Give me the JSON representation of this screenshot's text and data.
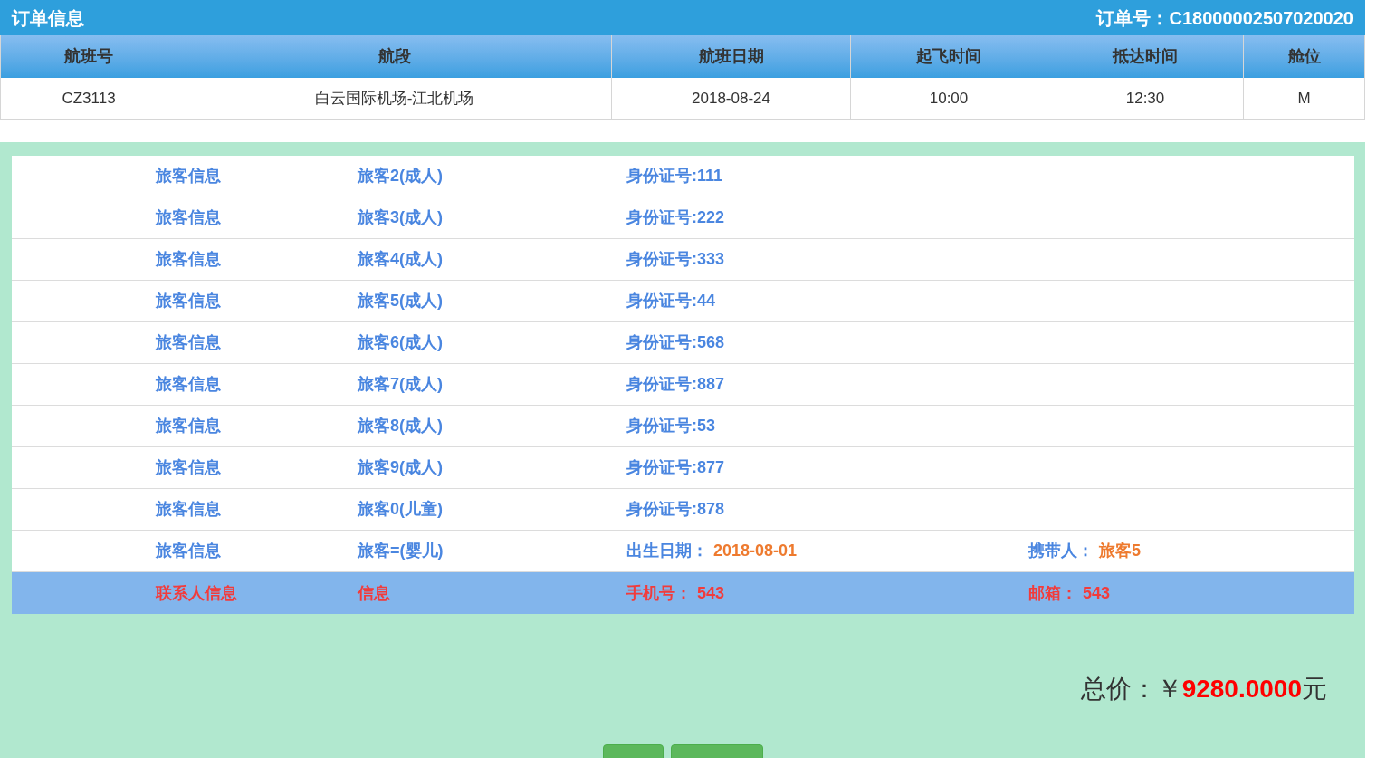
{
  "header": {
    "title": "订单信息",
    "order_number": "订单号：C18000002507020020"
  },
  "flight_table": {
    "columns": [
      "航班号",
      "航段",
      "航班日期",
      "起飞时间",
      "抵达时间",
      "舱位"
    ],
    "rows": [
      [
        "CZ3113",
        "白云国际机场-江北机场",
        "2018-08-24",
        "10:00",
        "12:30",
        "M"
      ]
    ]
  },
  "passenger_rows": [
    {
      "kind": "passenger",
      "cells": [
        {
          "text": "旅客信息"
        },
        {
          "text": "旅客2(成人)"
        },
        {
          "text": "身份证号:111"
        }
      ]
    },
    {
      "kind": "passenger",
      "cells": [
        {
          "text": "旅客信息"
        },
        {
          "text": "旅客3(成人)"
        },
        {
          "text": "身份证号:222"
        }
      ]
    },
    {
      "kind": "passenger",
      "cells": [
        {
          "text": "旅客信息"
        },
        {
          "text": "旅客4(成人)"
        },
        {
          "text": "身份证号:333"
        }
      ]
    },
    {
      "kind": "passenger",
      "cells": [
        {
          "text": "旅客信息"
        },
        {
          "text": "旅客5(成人)"
        },
        {
          "text": "身份证号:44"
        }
      ]
    },
    {
      "kind": "passenger",
      "cells": [
        {
          "text": "旅客信息"
        },
        {
          "text": "旅客6(成人)"
        },
        {
          "text": "身份证号:568"
        }
      ]
    },
    {
      "kind": "passenger",
      "cells": [
        {
          "text": "旅客信息"
        },
        {
          "text": "旅客7(成人)"
        },
        {
          "text": "身份证号:887"
        }
      ]
    },
    {
      "kind": "passenger",
      "cells": [
        {
          "text": "旅客信息"
        },
        {
          "text": "旅客8(成人)"
        },
        {
          "text": "身份证号:53"
        }
      ]
    },
    {
      "kind": "passenger",
      "cells": [
        {
          "text": "旅客信息"
        },
        {
          "text": "旅客9(成人)"
        },
        {
          "text": "身份证号:877"
        }
      ]
    },
    {
      "kind": "passenger",
      "cells": [
        {
          "text": "旅客信息"
        },
        {
          "text": "旅客0(儿童)"
        },
        {
          "text": "身份证号:878"
        }
      ]
    },
    {
      "kind": "passenger",
      "cells": [
        {
          "text": "旅客信息"
        },
        {
          "text": "旅客=(婴儿)"
        },
        {
          "label": "出生日期：",
          "value": "2018-08-01"
        },
        {
          "label": "携带人：",
          "value": "旅客5"
        }
      ]
    },
    {
      "kind": "contact",
      "cells": [
        {
          "text": "联系人信息"
        },
        {
          "text": "信息"
        },
        {
          "label": "手机号：",
          "value": "543"
        },
        {
          "label": "邮箱：",
          "value": "543"
        }
      ]
    }
  ],
  "total": {
    "label": "总价：￥",
    "amount": "9280.0000",
    "unit": "元"
  },
  "buttons": [
    {
      "kind": "short"
    },
    {
      "kind": "wide"
    }
  ]
}
